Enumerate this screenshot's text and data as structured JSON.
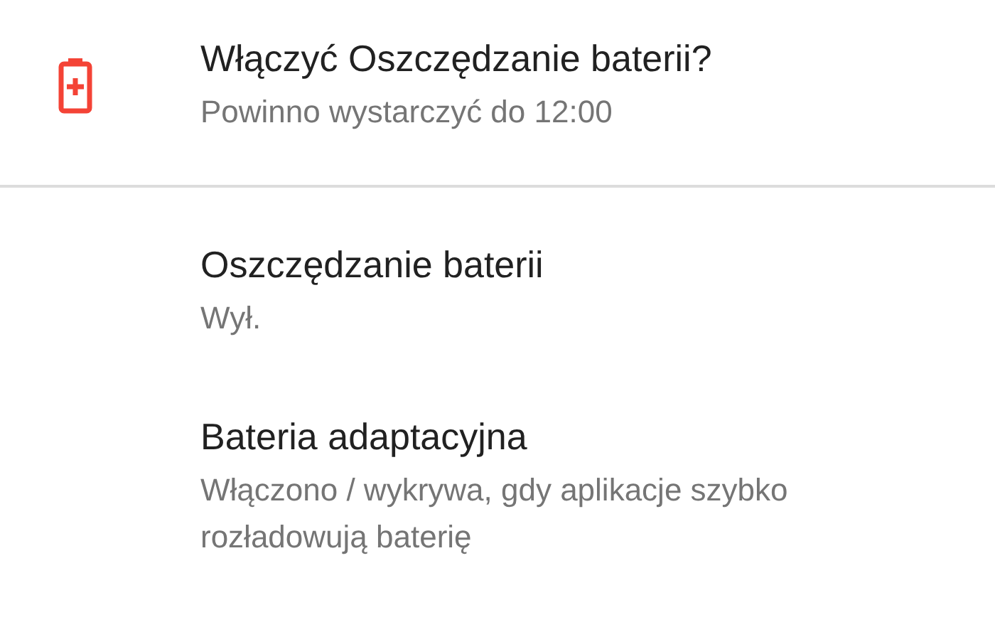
{
  "suggestion": {
    "title": "Włączyć Oszczędzanie baterii?",
    "subtitle": "Powinno wystarczyć do 12:00"
  },
  "settings": [
    {
      "title": "Oszczędzanie baterii",
      "subtitle": "Wył."
    },
    {
      "title": "Bateria adaptacyjna",
      "subtitle": "Włączono / wykrywa, gdy aplikacje szybko rozładowują baterię"
    }
  ]
}
